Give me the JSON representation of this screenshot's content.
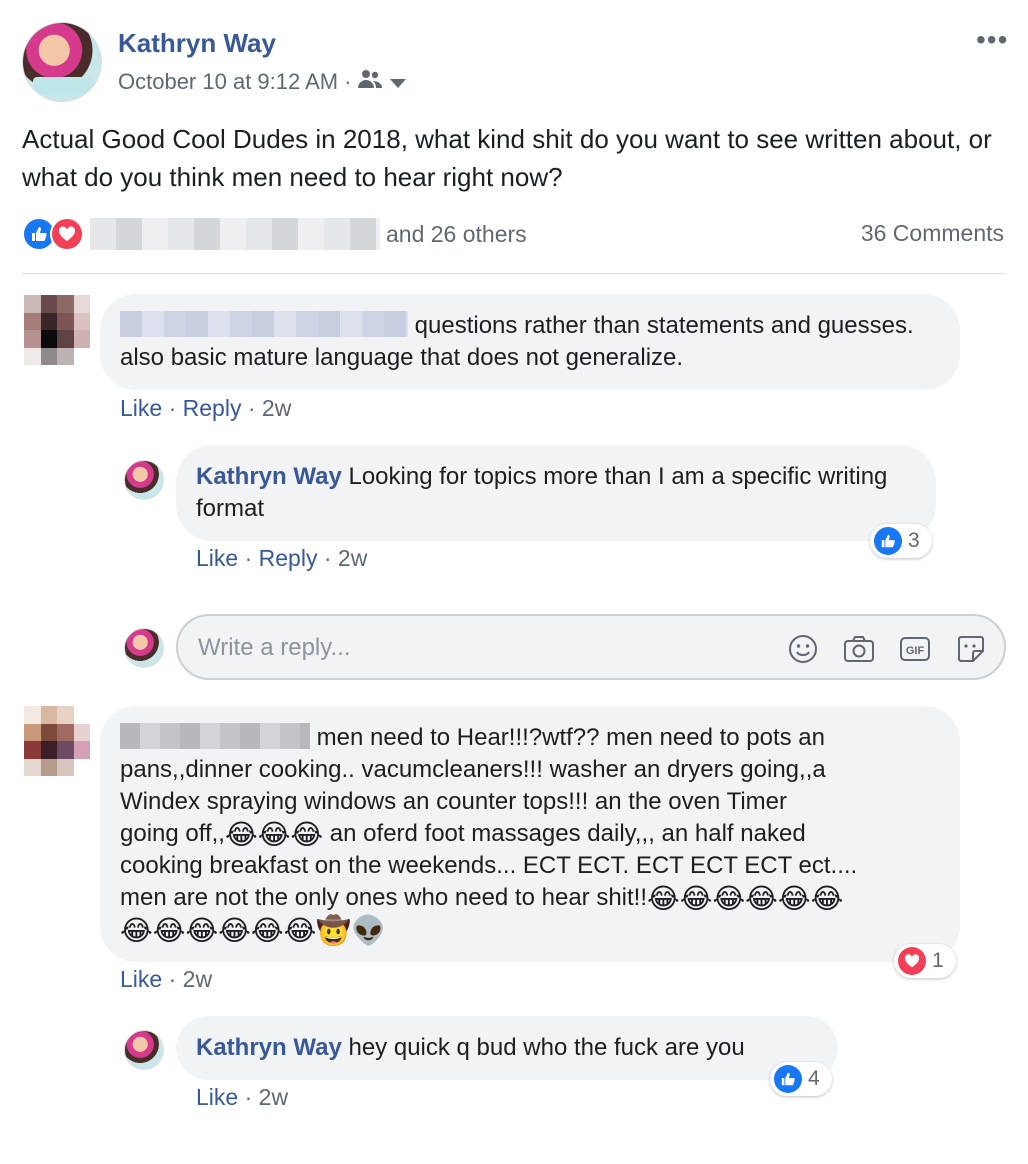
{
  "post": {
    "author": "Kathryn Way",
    "timestamp": "October 10 at 9:12 AM",
    "meta_separator": "·",
    "privacy_icon": "friends-icon",
    "text": "Actual Good Cool Dudes in 2018, what kind shit do you want to see written about, or what do you think men need to hear right now?",
    "reactions_others": "and 26 others",
    "comments_count": "36 Comments",
    "more_icon": "•••"
  },
  "comments": [
    {
      "text": " questions rather than statements and guesses. also basic mature language that does not generalize.",
      "like": "Like",
      "reply": "Reply",
      "sep": "·",
      "time": "2w"
    },
    {
      "author": "Kathryn Way",
      "text": " Looking for topics more than I am a specific writing format",
      "like": "Like",
      "reply": "Reply",
      "sep": "·",
      "time": "2w",
      "reaction_count": "3"
    },
    {
      "text_line1": "men need to Hear!!!?wtf?? men need to pots an",
      "text_line2": "pans,,dinner cooking.. vacumcleaners!!! washer an dryers going,,a",
      "text_line3": "Windex spraying windows an counter tops!!! an the oven Timer",
      "text_line4a": "going off,,",
      "text_line4b": " an oferd foot massages daily,,, an half naked",
      "text_line5": "cooking breakfast on the weekends... ECT ECT. ECT ECT ECT ect....",
      "text_line6": "men are not the only ones who need to hear shit!!",
      "like": "Like",
      "sep": "·",
      "time": "2w",
      "reaction_count": "1"
    },
    {
      "author": "Kathryn Way",
      "text": " hey quick q bud who the fuck are you",
      "like": "Like",
      "sep": "·",
      "time": "2w",
      "reaction_count": "4"
    }
  ],
  "reply_box": {
    "placeholder": "Write a reply..."
  },
  "emoji": {
    "laugh": "😂",
    "cowboy": "🤠",
    "alien": "👽"
  },
  "colors": {
    "link": "#385898",
    "like_blue": "#1877f2",
    "love_red": "#f33e58",
    "bubble": "#f2f3f5"
  }
}
